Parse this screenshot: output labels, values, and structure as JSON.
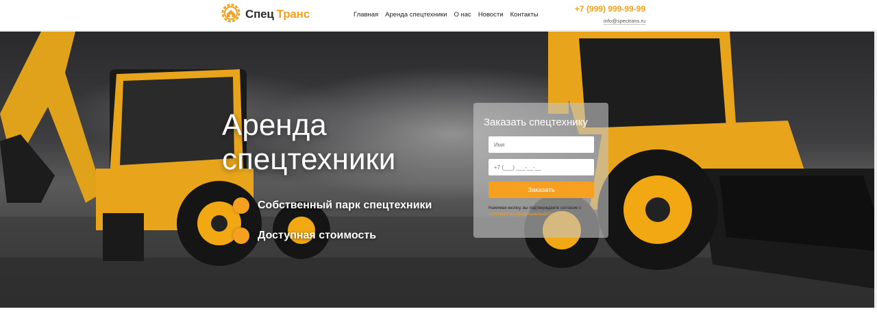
{
  "header": {
    "logo_spec": "Спец",
    "logo_trans": "Транс",
    "nav": [
      "Главная",
      "Аренда спецтехники",
      "О нас",
      "Новости",
      "Контакты"
    ],
    "phone": "+7 (999) 999-99-99",
    "email": "info@spectrans.ru"
  },
  "hero": {
    "title_line1": "Аренда",
    "title_line2": "спецтехники",
    "features": [
      "Собственный парк спецтехники",
      "Доступная стоимость"
    ]
  },
  "form": {
    "title": "Заказать спецтехнику",
    "name_placeholder": "Имя",
    "phone_placeholder": "+7 (___) ___-__-__",
    "submit_label": "Заказать",
    "note_text": "Нажимая кнопку, вы подтверждаете согласие с",
    "note_link": "политикой конфиденциальности"
  },
  "colors": {
    "accent": "#f5a020",
    "dark_text": "#2b2b2b"
  },
  "icons": {
    "logo": "gear-house-icon",
    "feature_bullet": "orange-dot"
  }
}
